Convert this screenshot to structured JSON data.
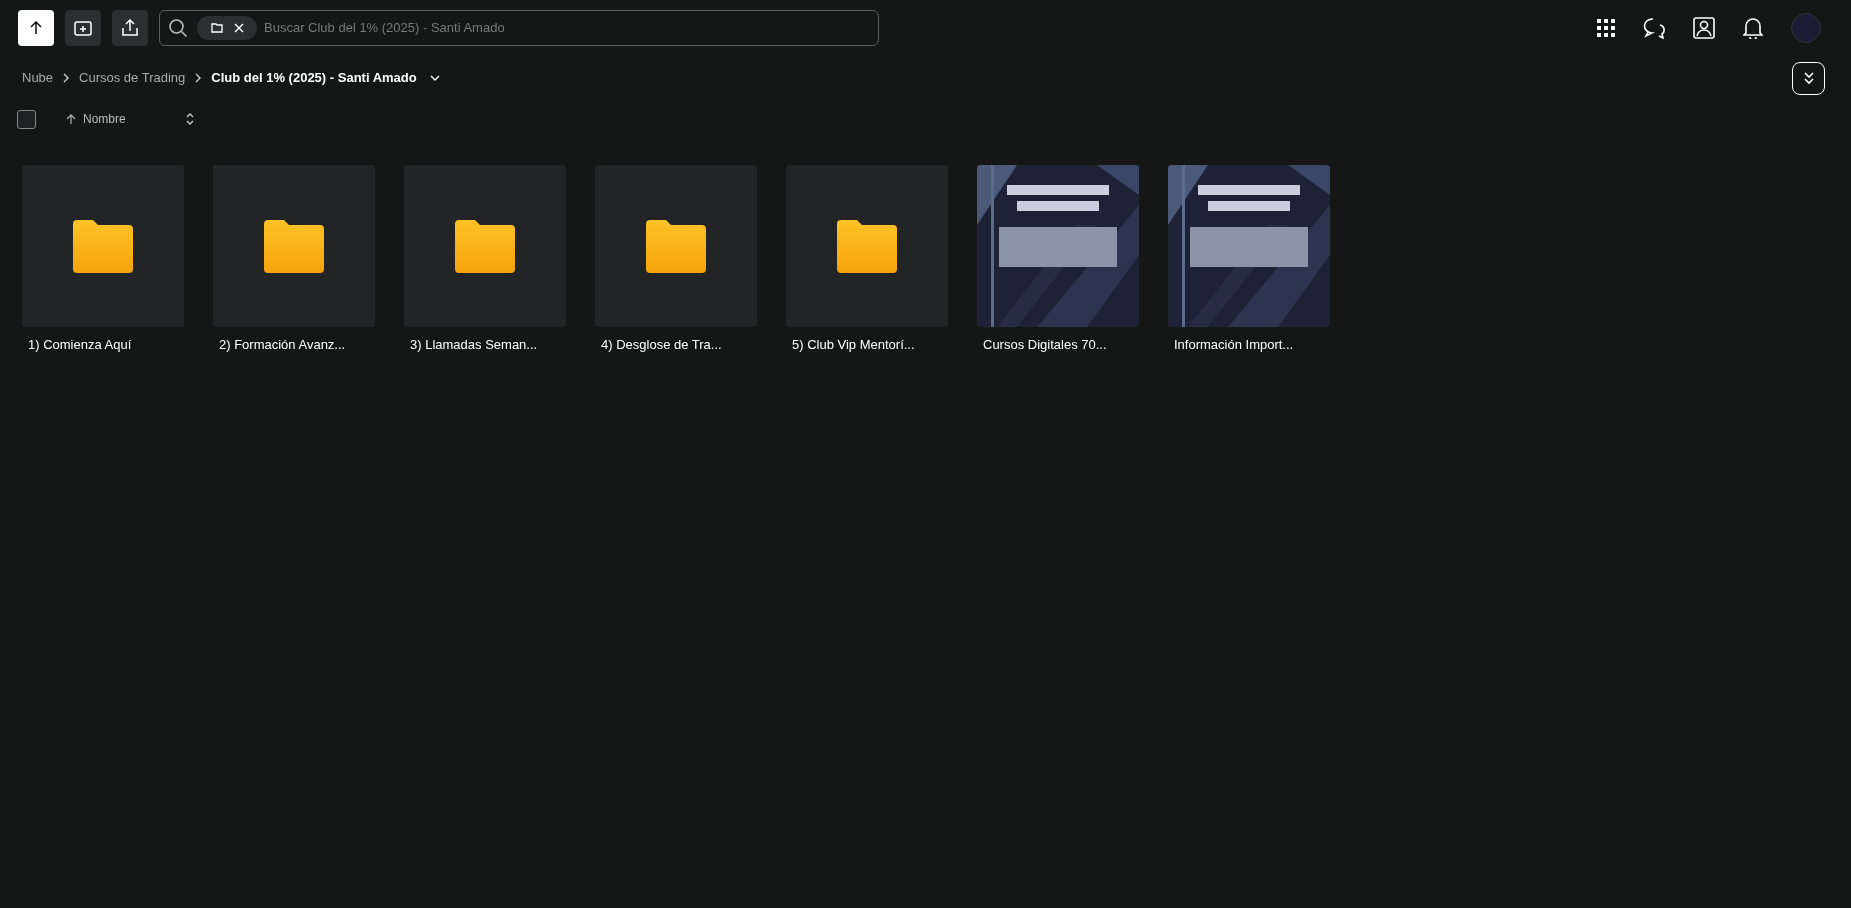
{
  "toolbar": {
    "search": {
      "placeholder": "Buscar Club del 1% (2025) - Santi Amado"
    }
  },
  "breadcrumb": [
    {
      "label": "Nube",
      "current": false
    },
    {
      "label": "Cursos de Trading",
      "current": false
    },
    {
      "label": "Club del 1% (2025) - Santi Amado",
      "current": true
    }
  ],
  "list_header": {
    "select_all": {
      "checked": false
    },
    "sort": {
      "label": "Nombre"
    }
  },
  "items": [
    {
      "kind": "folder",
      "name": "1) Comienza Aquí"
    },
    {
      "kind": "folder",
      "name": "2) Formación Avanz..."
    },
    {
      "kind": "folder",
      "name": "3) Llamadas Seman..."
    },
    {
      "kind": "folder",
      "name": "4) Desglose de Tra..."
    },
    {
      "kind": "folder",
      "name": "5) Club Vip Mentorí..."
    },
    {
      "kind": "picture",
      "name": "Cursos Digitales 70..."
    },
    {
      "kind": "picture",
      "name": "Información Import..."
    }
  ]
}
